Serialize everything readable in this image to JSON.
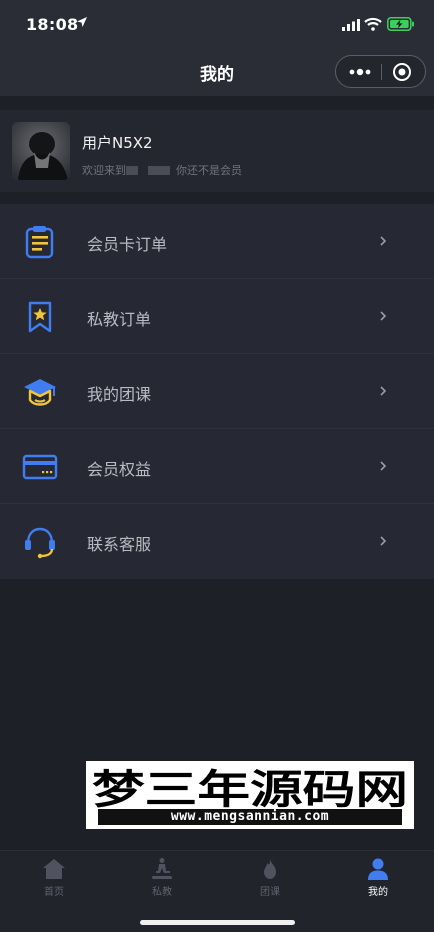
{
  "status_bar": {
    "time": "18:08"
  },
  "nav": {
    "title": "我的"
  },
  "profile": {
    "username": "用户N5X2",
    "welcome_text": "欢迎来到",
    "member_status": "你还不是会员"
  },
  "menu": {
    "items": [
      {
        "label": "会员卡订单",
        "icon": "clipboard-icon"
      },
      {
        "label": "私教订单",
        "icon": "bookmark-star-icon"
      },
      {
        "label": "我的团课",
        "icon": "graduation-cap-icon"
      },
      {
        "label": "会员权益",
        "icon": "card-icon"
      },
      {
        "label": "联系客服",
        "icon": "headset-icon"
      }
    ]
  },
  "watermark": {
    "title": "梦三年源码网",
    "url": "www.mengsannian.com"
  },
  "tabs": [
    {
      "label": "首页",
      "icon": "home-icon"
    },
    {
      "label": "私教",
      "icon": "treadmill-icon"
    },
    {
      "label": "团课",
      "icon": "flame-icon"
    },
    {
      "label": "我的",
      "icon": "person-icon",
      "active": true
    }
  ],
  "colors": {
    "accent_blue": "#3f7df0",
    "accent_yellow": "#f2c33d",
    "background": "#1e2027",
    "menu_background": "#262934"
  }
}
